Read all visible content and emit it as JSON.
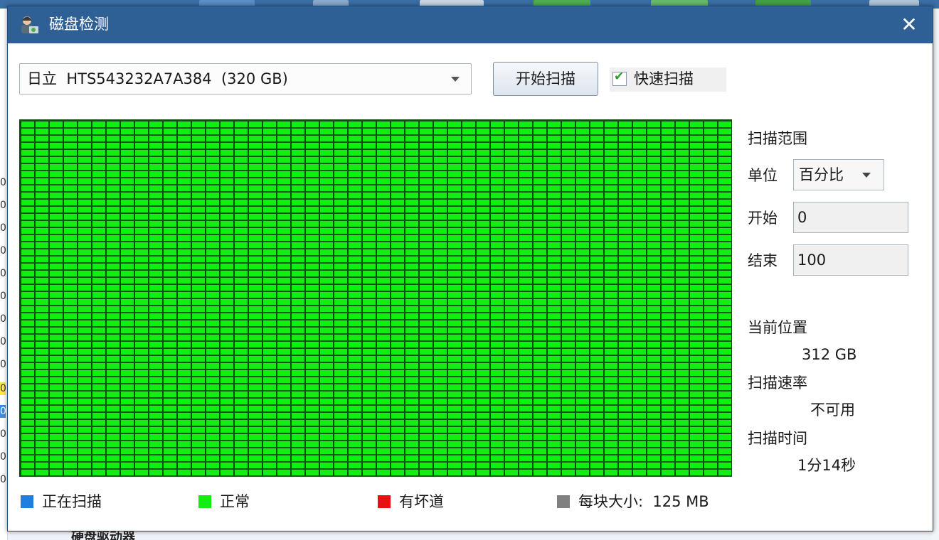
{
  "window": {
    "title": "磁盘检测",
    "close_glyph": "✕"
  },
  "toolbar": {
    "drive": "日立  HTS543232A7A384  (320 GB)",
    "scan_button": "开始扫描",
    "quick_scan_label": "快速扫描",
    "quick_scan_checked": true
  },
  "scan_grid": {
    "rows": 50,
    "cols": 50,
    "block_status": "正常",
    "color": "#11ee11"
  },
  "side": {
    "range_title": "扫描范围",
    "unit_label": "单位",
    "unit_value": "百分比",
    "start_label": "开始",
    "start_value": "0",
    "end_label": "结束",
    "end_value": "100",
    "position_label": "当前位置",
    "position_value": "312 GB",
    "rate_label": "扫描速率",
    "rate_value": "不可用",
    "time_label": "扫描时间",
    "time_value": "1分14秒"
  },
  "legend": [
    {
      "label": "正在扫描",
      "color": "#1e7fe0"
    },
    {
      "label": "正常",
      "color": "#11ee11"
    },
    {
      "label": "有坏道",
      "color": "#e81010"
    },
    {
      "label": "每块大小:  125 MB",
      "color": "#808080"
    }
  ],
  "background": {
    "bottom_text": "硬盘驱动器"
  }
}
